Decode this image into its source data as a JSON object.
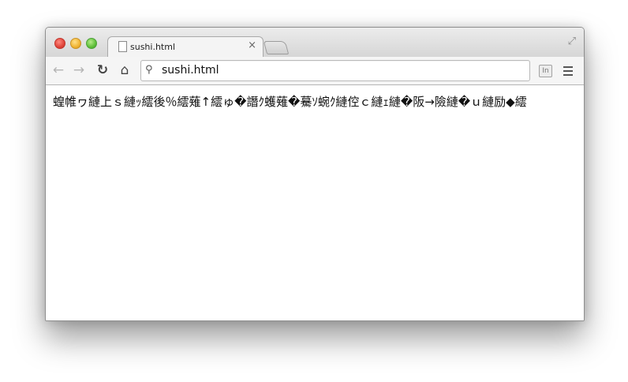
{
  "browser": {
    "tab_title": "sushi.html",
    "tab_close_glyph": "×",
    "address_bar_text": "sushi.html",
    "extension_label": "In",
    "icons": {
      "back": "back-arrow-icon",
      "forward": "forward-arrow-icon",
      "reload": "reload-icon",
      "home": "home-icon",
      "search": "search-icon",
      "menu": "hamburger-menu-icon",
      "fullscreen": "fullscreen-icon",
      "file": "file-icon"
    },
    "colors": {
      "close": "#e0443a",
      "minimize": "#f0b332",
      "maximize": "#5fbf3a"
    }
  },
  "page": {
    "body_text": "蝗帷ヮ縺上ｓ縺ｯ繧後％繧薙↑繧ゅ�譖ｸ蠖薙�驀ｿ蜿ｸ縺倥ｃ縺ｪ縺�阪→險縺�ｕ縺励◆繧"
  }
}
